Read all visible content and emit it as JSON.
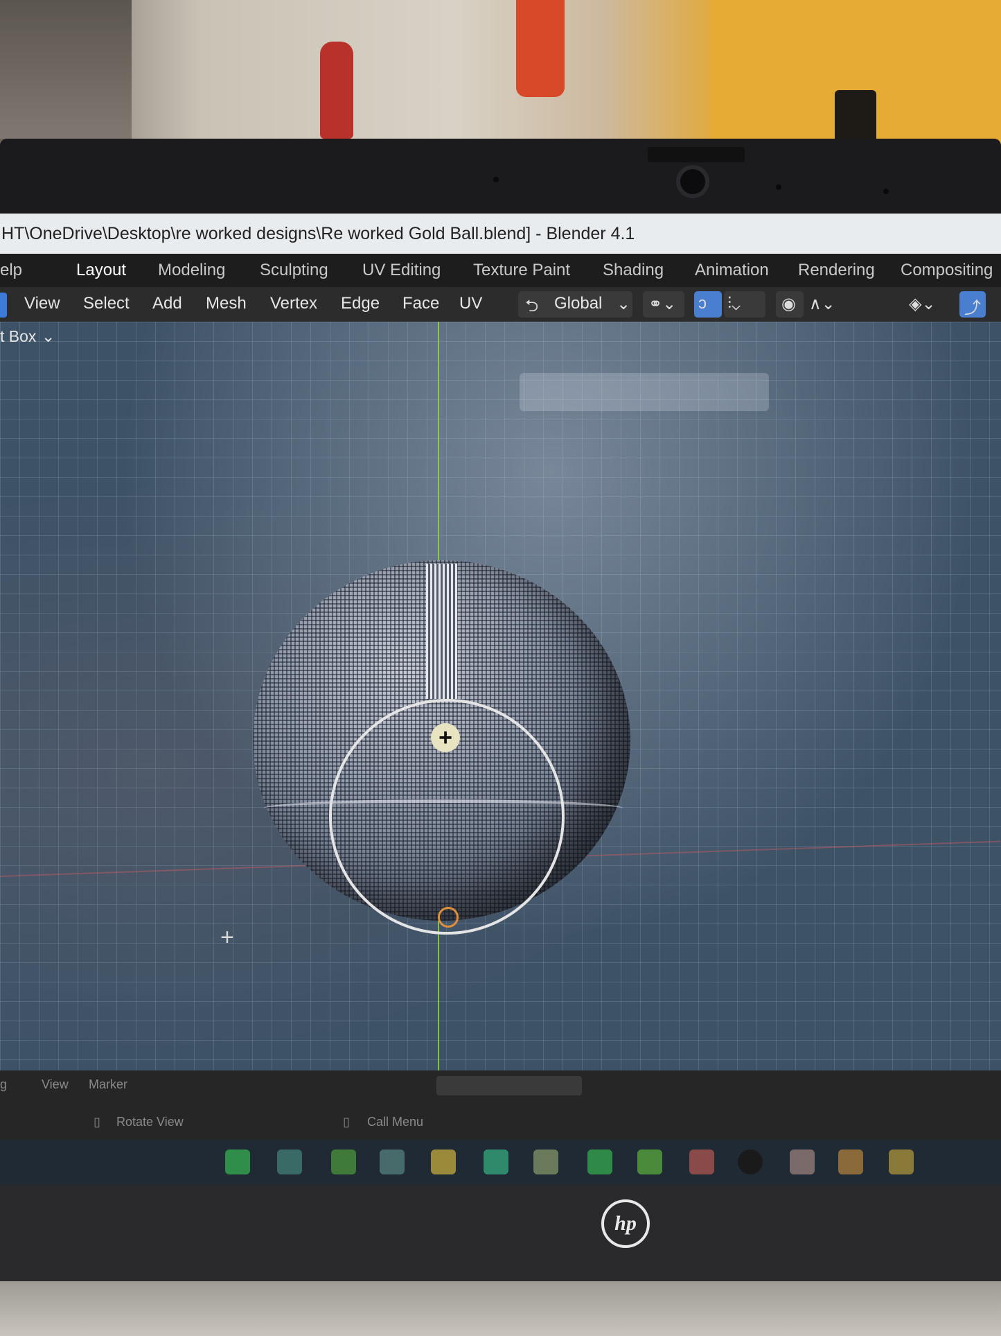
{
  "window": {
    "title": "HT\\OneDrive\\Desktop\\re worked designs\\Re worked Gold Ball.blend] - Blender 4.1"
  },
  "workspaces": {
    "help": "elp",
    "tabs": [
      "Layout",
      "Modeling",
      "Sculpting",
      "UV Editing",
      "Texture Paint",
      "Shading",
      "Animation",
      "Rendering",
      "Compositing"
    ],
    "active": "Layout"
  },
  "header": {
    "menus": [
      "View",
      "Select",
      "Add",
      "Mesh",
      "Vertex",
      "Edge",
      "Face",
      "UV"
    ],
    "transform_orientation": "Global"
  },
  "tool": {
    "select_mode": "t Box"
  },
  "timeline": {
    "menus": [
      "View",
      "Marker"
    ],
    "left_dropdown": "g"
  },
  "statusbar": {
    "items": [
      "Rotate View",
      "Call Menu"
    ]
  },
  "device": {
    "brand": "hp"
  },
  "colors": {
    "accent": "#4a7fd0",
    "y_axis": "#96d750",
    "x_axis": "#c85a64"
  }
}
